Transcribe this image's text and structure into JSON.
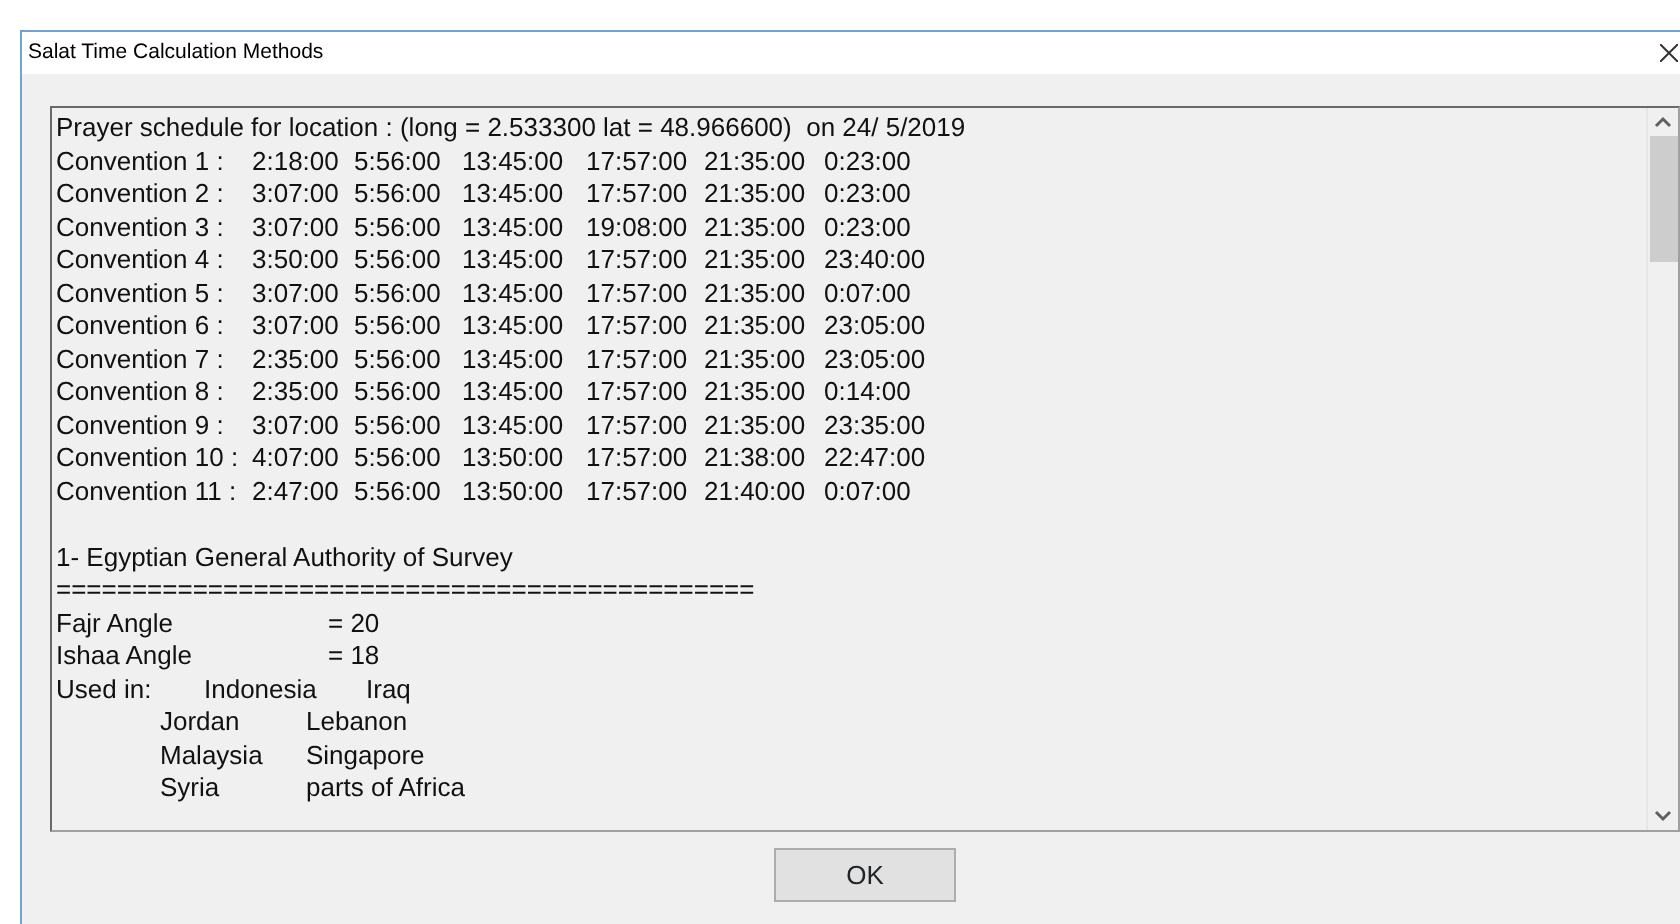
{
  "window": {
    "title": "Salat Time Calculation Methods"
  },
  "text_area": {
    "lines": [
      {
        "kind": "text",
        "cells": [
          "Prayer schedule for location : (long = 2.533300 lat = 48.966600)  on 24/ 5/2019"
        ]
      },
      {
        "kind": "schedule",
        "cells": [
          "Convention 1 :",
          "2:18:00",
          "5:56:00",
          "13:45:00",
          "17:57:00",
          "21:35:00",
          "0:23:00"
        ]
      },
      {
        "kind": "schedule",
        "cells": [
          "Convention 2 :",
          "3:07:00",
          "5:56:00",
          "13:45:00",
          "17:57:00",
          "21:35:00",
          "0:23:00"
        ]
      },
      {
        "kind": "schedule",
        "cells": [
          "Convention 3 :",
          "3:07:00",
          "5:56:00",
          "13:45:00",
          "19:08:00",
          "21:35:00",
          "0:23:00"
        ]
      },
      {
        "kind": "schedule",
        "cells": [
          "Convention 4 :",
          "3:50:00",
          "5:56:00",
          "13:45:00",
          "17:57:00",
          "21:35:00",
          "23:40:00"
        ]
      },
      {
        "kind": "schedule",
        "cells": [
          "Convention 5 :",
          "3:07:00",
          "5:56:00",
          "13:45:00",
          "17:57:00",
          "21:35:00",
          "0:07:00"
        ]
      },
      {
        "kind": "schedule",
        "cells": [
          "Convention 6 :",
          "3:07:00",
          "5:56:00",
          "13:45:00",
          "17:57:00",
          "21:35:00",
          "23:05:00"
        ]
      },
      {
        "kind": "schedule",
        "cells": [
          "Convention 7 :",
          "2:35:00",
          "5:56:00",
          "13:45:00",
          "17:57:00",
          "21:35:00",
          "23:05:00"
        ]
      },
      {
        "kind": "schedule",
        "cells": [
          "Convention 8 :",
          "2:35:00",
          "5:56:00",
          "13:45:00",
          "17:57:00",
          "21:35:00",
          "0:14:00"
        ]
      },
      {
        "kind": "schedule",
        "cells": [
          "Convention 9 :",
          "3:07:00",
          "5:56:00",
          "13:45:00",
          "17:57:00",
          "21:35:00",
          "23:35:00"
        ]
      },
      {
        "kind": "schedule",
        "cells": [
          "Convention 10 :",
          "4:07:00",
          "5:56:00",
          "13:50:00",
          "17:57:00",
          "21:38:00",
          "22:47:00"
        ]
      },
      {
        "kind": "schedule",
        "cells": [
          "Convention 11 :",
          "2:47:00",
          "5:56:00",
          "13:50:00",
          "17:57:00",
          "21:40:00",
          "0:07:00"
        ]
      },
      {
        "kind": "spacer"
      },
      {
        "kind": "text",
        "cells": [
          "1- Egyptian General Authority of Survey"
        ]
      },
      {
        "kind": "text",
        "cells": [
          "=============================================="
        ]
      },
      {
        "kind": "setting",
        "cells": [
          "Fajr Angle",
          "= 20"
        ]
      },
      {
        "kind": "setting",
        "cells": [
          "Ishaa Angle",
          "= 18"
        ]
      },
      {
        "kind": "usage",
        "cells": [
          "Used in:",
          "Indonesia",
          "Iraq"
        ]
      },
      {
        "kind": "usage_more",
        "cells": [
          "Jordan",
          "Lebanon"
        ]
      },
      {
        "kind": "usage_more",
        "cells": [
          "Malaysia",
          "Singapore"
        ]
      },
      {
        "kind": "usage_more",
        "cells": [
          "Syria",
          "parts of Africa"
        ]
      }
    ]
  },
  "buttons": [
    {
      "label": "OK"
    }
  ]
}
